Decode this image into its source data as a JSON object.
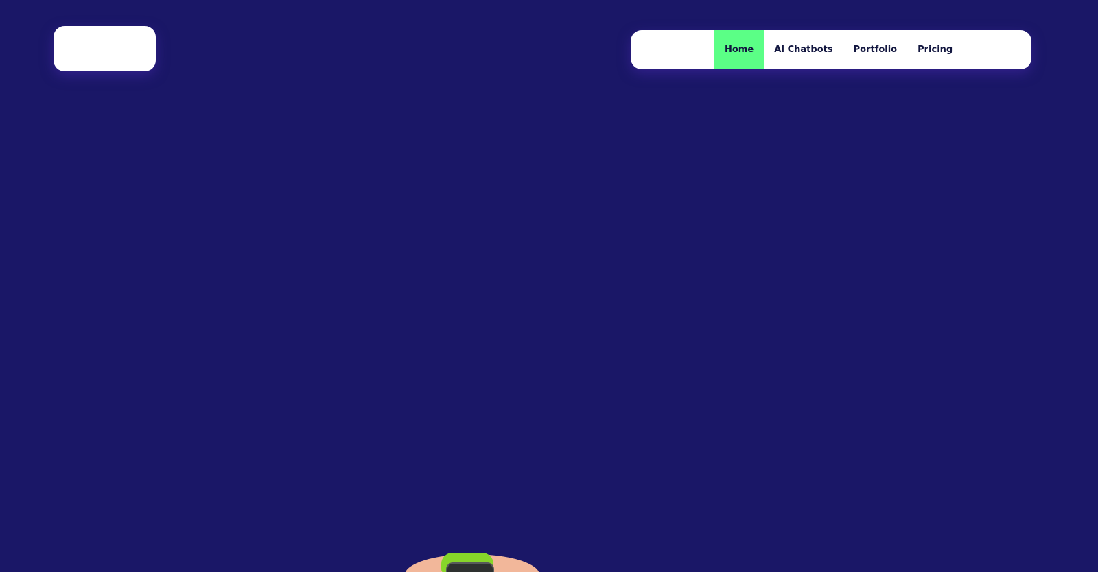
{
  "header": {
    "logo": {
      "icon": "logo-placeholder"
    },
    "nav": {
      "items": [
        {
          "label": "Home",
          "active": true
        },
        {
          "label": "AI Chatbots",
          "active": false
        },
        {
          "label": "Portfolio",
          "active": false
        },
        {
          "label": "Pricing",
          "active": false
        }
      ]
    }
  },
  "hero": {
    "image": {
      "icon": "smartwatch-on-wrist-image"
    }
  },
  "colors": {
    "background": "#1a1767",
    "nav_background": "#ffffff",
    "active_nav": "#5bff86",
    "nav_text": "#12163f"
  }
}
